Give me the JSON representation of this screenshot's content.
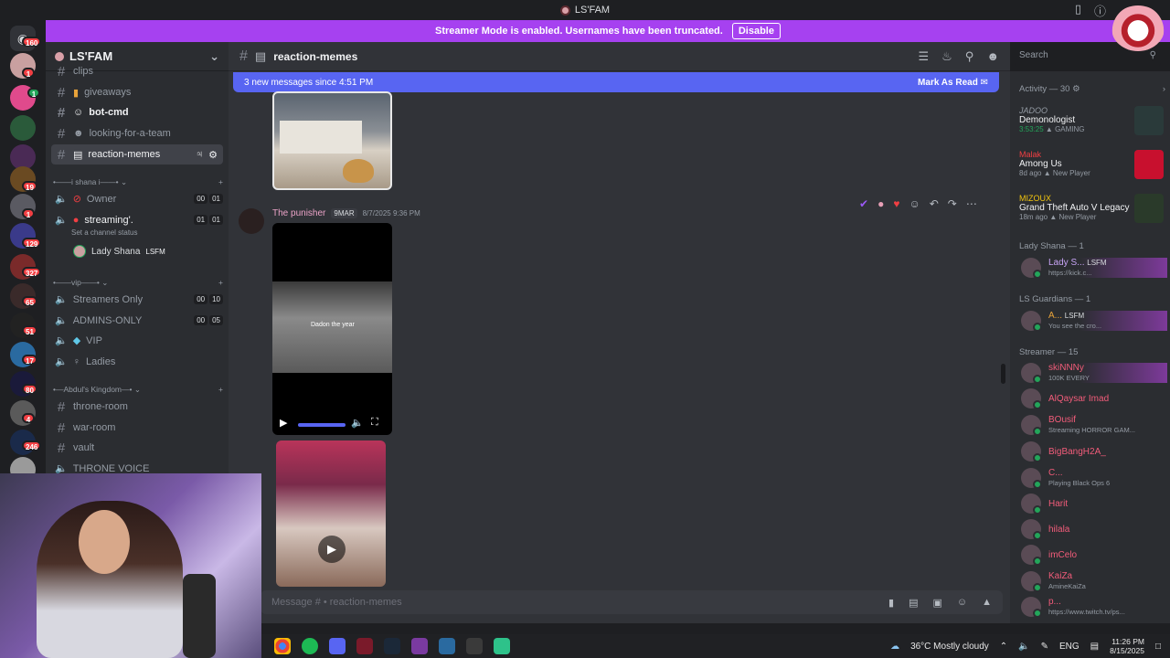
{
  "window": {
    "title": "LS'FAM"
  },
  "banner": {
    "text": "Streamer Mode is enabled. Usernames have been truncated.",
    "button": "Disable"
  },
  "guild_badges": [
    "160",
    "1",
    "1",
    "19",
    "1",
    "129",
    "327",
    "65",
    "51",
    "17",
    "80",
    "4",
    "246"
  ],
  "server": {
    "name": "LS'FAM"
  },
  "channels": {
    "clips": "clips",
    "giveaways": "giveaways",
    "bot_cmd": "bot-cmd",
    "looking": "looking-for-a-team",
    "reaction": "reaction-memes",
    "cat_shana": "i shana i",
    "owner": "Owner",
    "owner_counts": [
      "00",
      "01"
    ],
    "streaming": "streaming'.",
    "streaming_counts": [
      "01",
      "01"
    ],
    "status_hint": "Set a channel status",
    "lady": "Lady Shana",
    "lady_tag": "LSFM",
    "cat_vip": "vip",
    "streamers_only": "Streamers Only",
    "streamers_counts": [
      "00",
      "10"
    ],
    "admins": "ADMINS-ONLY",
    "admins_counts": [
      "00",
      "05"
    ],
    "vip": "VIP",
    "ladies": "Ladies",
    "cat_abdul": "Abdul's Kingdom",
    "throne": "throne-room",
    "war": "war-room",
    "vault": "vault",
    "throne_voice": "THRONE VOICE"
  },
  "topbar": {
    "channel": "reaction-memes"
  },
  "search": {
    "placeholder": "Search"
  },
  "newbar": {
    "text": "3 new messages since 4:51 PM",
    "mark": "Mark As Read"
  },
  "message": {
    "author": "The punisher",
    "tag": "9MAR",
    "time": "8/7/2025 9:36 PM",
    "video_caption": "Dadon the year"
  },
  "composer": {
    "placeholder": "Message #  • reaction-memes"
  },
  "activity": {
    "header": "Activity — 30",
    "items": [
      {
        "user": "JADOO",
        "game": "Demonologist",
        "sub": "3:53:25",
        "tag": "GAMING"
      },
      {
        "user": "Malak",
        "game": "Among Us",
        "sub": "8d ago",
        "tag": "New Player"
      },
      {
        "user": "MIZOUX",
        "game": "Grand Theft Auto V Legacy",
        "sub": "18m ago",
        "tag": "New Player"
      }
    ]
  },
  "members": {
    "sec_lady": "Lady Shana — 1",
    "lady": {
      "name": "Lady S...",
      "tag": "LSFM",
      "sub": "https://kick.c..."
    },
    "sec_guardians": "LS Guardians — 1",
    "guardian": {
      "name": "A...",
      "tag": "LSFM",
      "sub": "You see the cro..."
    },
    "sec_streamer": "Streamer — 15",
    "list": [
      {
        "name": "skiNNNy",
        "sub": "100K EVERY"
      },
      {
        "name": "AlQaysar Imad",
        "sub": ""
      },
      {
        "name": "BOusif",
        "sub": "Streaming HORROR GAM..."
      },
      {
        "name": "BigBangH2A_",
        "sub": ""
      },
      {
        "name": "C...",
        "sub": "Playing Black Ops 6"
      },
      {
        "name": "Harit",
        "sub": ""
      },
      {
        "name": "hilala",
        "sub": ""
      },
      {
        "name": "imCelo",
        "sub": ""
      },
      {
        "name": "KaiZa",
        "sub": "AmineKaiZa"
      },
      {
        "name": "p...",
        "sub": "https://www.twitch.tv/ps..."
      }
    ]
  },
  "tray": {
    "weather": "36°C  Mostly cloudy",
    "lang": "ENG",
    "time": "11:26 PM",
    "date": "8/15/2025"
  },
  "colors": {
    "accent": "#5865f2",
    "banner": "#a641f0",
    "bg": "#313338"
  }
}
